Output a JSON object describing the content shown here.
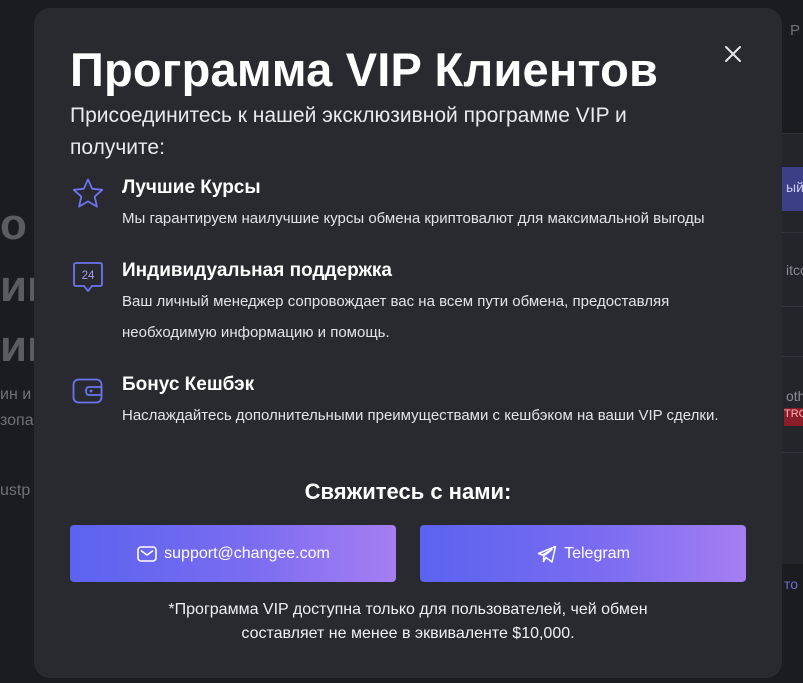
{
  "background": {
    "left_fragments": [
      "о",
      "ин",
      "им",
      "ин и",
      "зопа",
      "ustp"
    ],
    "right_fragments": [
      "ый",
      "itco",
      "othe",
      "TRO",
      "то"
    ],
    "top_right_fragment": "P"
  },
  "modal": {
    "title": "Программа VIP Клиентов",
    "subtitle": "Присоединитесь к нашей эксклюзивной программе VIP и получите:",
    "features": [
      {
        "icon": "star-icon",
        "heading": "Лучшие Курсы",
        "description": "Мы гарантируем наилучшие курсы обмена криптовалют для максимальной выгоды"
      },
      {
        "icon": "support-24-icon",
        "heading": "Индивидуальная поддержка",
        "description": "Ваш личный менеджер сопровождает вас на всем пути обмена, предоставляя необходимую информацию и помощь."
      },
      {
        "icon": "wallet-icon",
        "heading": "Бонус Кешбэк",
        "description": "Наслаждайтесь дополнительными преимуществами с кешбэком на ваши VIP сделки."
      }
    ],
    "contact_title": "Свяжитесь с нами:",
    "email_label": "support@changee.com",
    "telegram_label": "Telegram",
    "footnote_line1": "*Программа VIP доступна только для пользователей, чей обмен",
    "footnote_line2": "составляет не менее в эквиваленте $10,000.",
    "support_icon_text": "24"
  },
  "colors": {
    "modal_bg": "#282a2f",
    "accent": "#5b63ef",
    "accent_end": "#a57ef2",
    "icon_stroke": "#6d74f0"
  }
}
